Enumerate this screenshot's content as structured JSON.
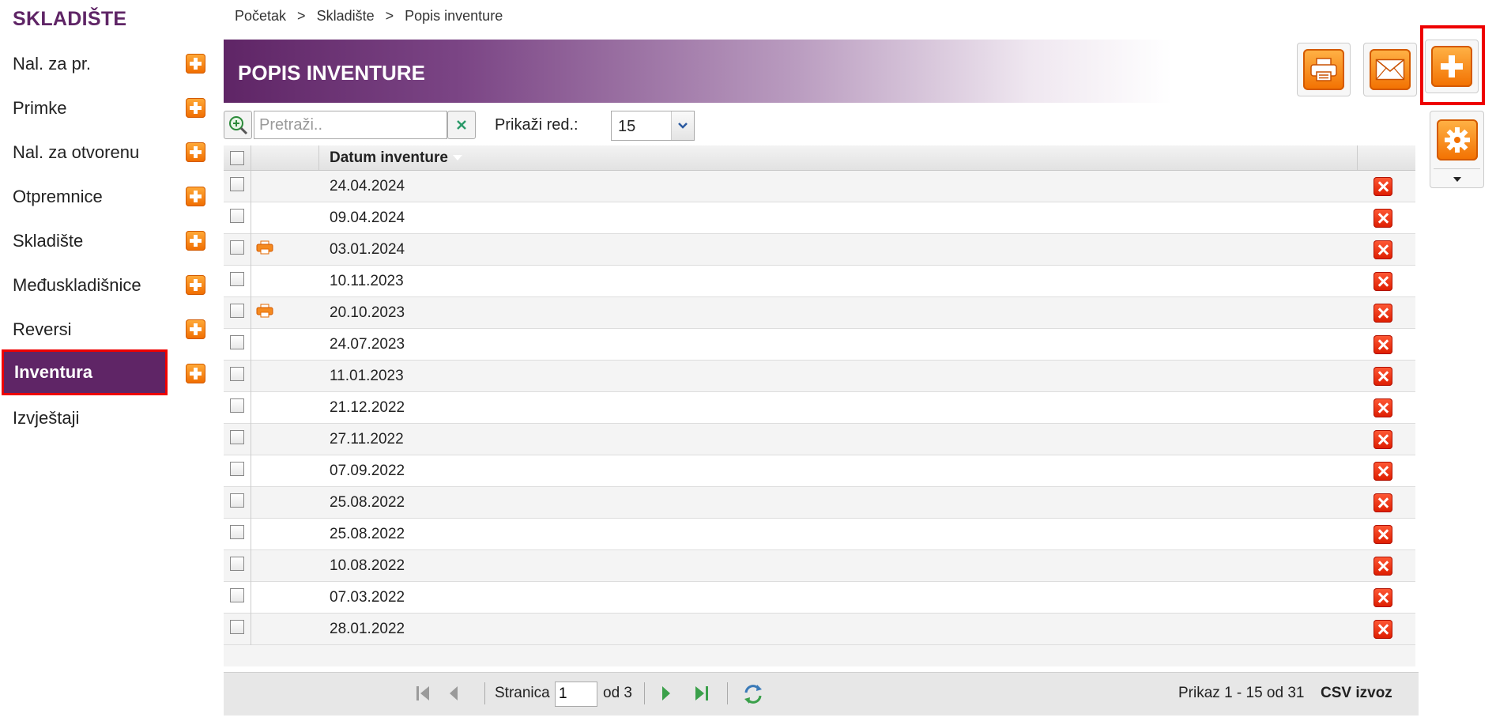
{
  "sidebar": {
    "title": "SKLADIŠTE",
    "items": [
      {
        "label": "Nal. za pr.",
        "has_add": true
      },
      {
        "label": "Primke",
        "has_add": true
      },
      {
        "label": "Nal. za otvorenu",
        "has_add": true
      },
      {
        "label": "Otpremnice",
        "has_add": true
      },
      {
        "label": "Skladište",
        "has_add": true
      },
      {
        "label": "Međuskladišnice",
        "has_add": true
      },
      {
        "label": "Reversi",
        "has_add": true
      },
      {
        "label": "Inventura",
        "has_add": true,
        "active": true
      },
      {
        "label": "Izvještaji",
        "has_add": false
      }
    ]
  },
  "breadcrumb": {
    "items": [
      "Početak",
      "Skladište",
      "Popis inventure"
    ],
    "separator": ">"
  },
  "header": {
    "title": "POPIS INVENTURE",
    "accent_color": "#5f2566"
  },
  "toolbar": {
    "buttons": [
      "printer-icon",
      "mail-icon",
      "plus-icon",
      "gear-icon"
    ]
  },
  "search": {
    "placeholder": "Pretraži..",
    "value": ""
  },
  "rows_per_page": {
    "label": "Prikaži red.:",
    "value": "15"
  },
  "table": {
    "columns": [
      "Datum inventure"
    ],
    "rows": [
      {
        "date": "24.04.2024",
        "printed": false
      },
      {
        "date": "09.04.2024",
        "printed": false
      },
      {
        "date": "03.01.2024",
        "printed": true
      },
      {
        "date": "10.11.2023",
        "printed": false
      },
      {
        "date": "20.10.2023",
        "printed": true
      },
      {
        "date": "24.07.2023",
        "printed": false
      },
      {
        "date": "11.01.2023",
        "printed": false
      },
      {
        "date": "21.12.2022",
        "printed": false
      },
      {
        "date": "27.11.2022",
        "printed": false
      },
      {
        "date": "07.09.2022",
        "printed": false
      },
      {
        "date": "25.08.2022",
        "printed": false
      },
      {
        "date": "25.08.2022",
        "printed": false
      },
      {
        "date": "10.08.2022",
        "printed": false
      },
      {
        "date": "07.03.2022",
        "printed": false
      },
      {
        "date": "28.01.2022",
        "printed": false
      }
    ]
  },
  "pager": {
    "page_label": "Stranica",
    "page_value": "1",
    "of_label": "od 3",
    "info": "Prikaz 1 - 15 od 31",
    "csv_label": "CSV izvoz"
  }
}
